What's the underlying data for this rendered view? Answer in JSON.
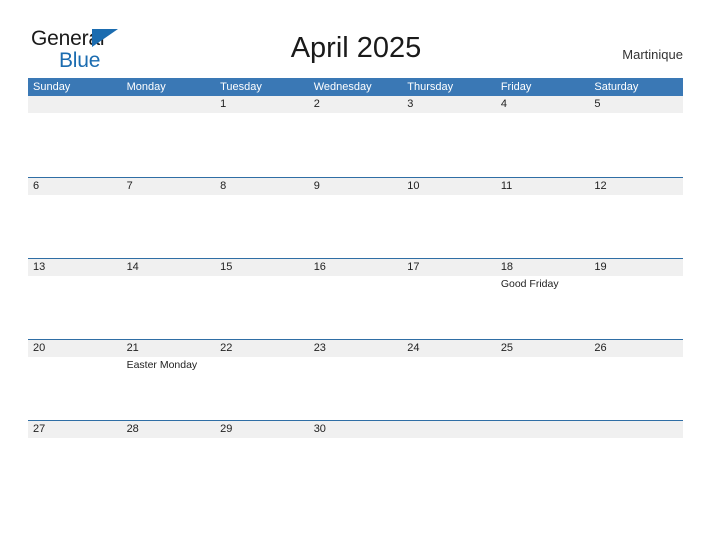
{
  "brand": {
    "line1": "General",
    "line2": "Blue",
    "triangle_icon": "triangle-icon",
    "accent_color": "#1b6cb0"
  },
  "header": {
    "title": "April 2025",
    "region": "Martinique"
  },
  "theme": {
    "header_blue": "#3a78b5",
    "row_border_blue": "#2f6ea5",
    "date_band_gray": "#f0f0f0",
    "text_dark": "#222222",
    "page_background": "#ffffff"
  },
  "calendar": {
    "weekdays": [
      "Sunday",
      "Monday",
      "Tuesday",
      "Wednesday",
      "Thursday",
      "Friday",
      "Saturday"
    ],
    "weeks": [
      [
        {
          "day": "",
          "events": []
        },
        {
          "day": "",
          "events": []
        },
        {
          "day": "1",
          "events": []
        },
        {
          "day": "2",
          "events": []
        },
        {
          "day": "3",
          "events": []
        },
        {
          "day": "4",
          "events": []
        },
        {
          "day": "5",
          "events": []
        }
      ],
      [
        {
          "day": "6",
          "events": []
        },
        {
          "day": "7",
          "events": []
        },
        {
          "day": "8",
          "events": []
        },
        {
          "day": "9",
          "events": []
        },
        {
          "day": "10",
          "events": []
        },
        {
          "day": "11",
          "events": []
        },
        {
          "day": "12",
          "events": []
        }
      ],
      [
        {
          "day": "13",
          "events": []
        },
        {
          "day": "14",
          "events": []
        },
        {
          "day": "15",
          "events": []
        },
        {
          "day": "16",
          "events": []
        },
        {
          "day": "17",
          "events": []
        },
        {
          "day": "18",
          "events": [
            "Good Friday"
          ]
        },
        {
          "day": "19",
          "events": []
        }
      ],
      [
        {
          "day": "20",
          "events": []
        },
        {
          "day": "21",
          "events": [
            "Easter Monday"
          ]
        },
        {
          "day": "22",
          "events": []
        },
        {
          "day": "23",
          "events": []
        },
        {
          "day": "24",
          "events": []
        },
        {
          "day": "25",
          "events": []
        },
        {
          "day": "26",
          "events": []
        }
      ],
      [
        {
          "day": "27",
          "events": []
        },
        {
          "day": "28",
          "events": []
        },
        {
          "day": "29",
          "events": []
        },
        {
          "day": "30",
          "events": []
        },
        {
          "day": "",
          "events": []
        },
        {
          "day": "",
          "events": []
        },
        {
          "day": "",
          "events": []
        }
      ]
    ]
  }
}
